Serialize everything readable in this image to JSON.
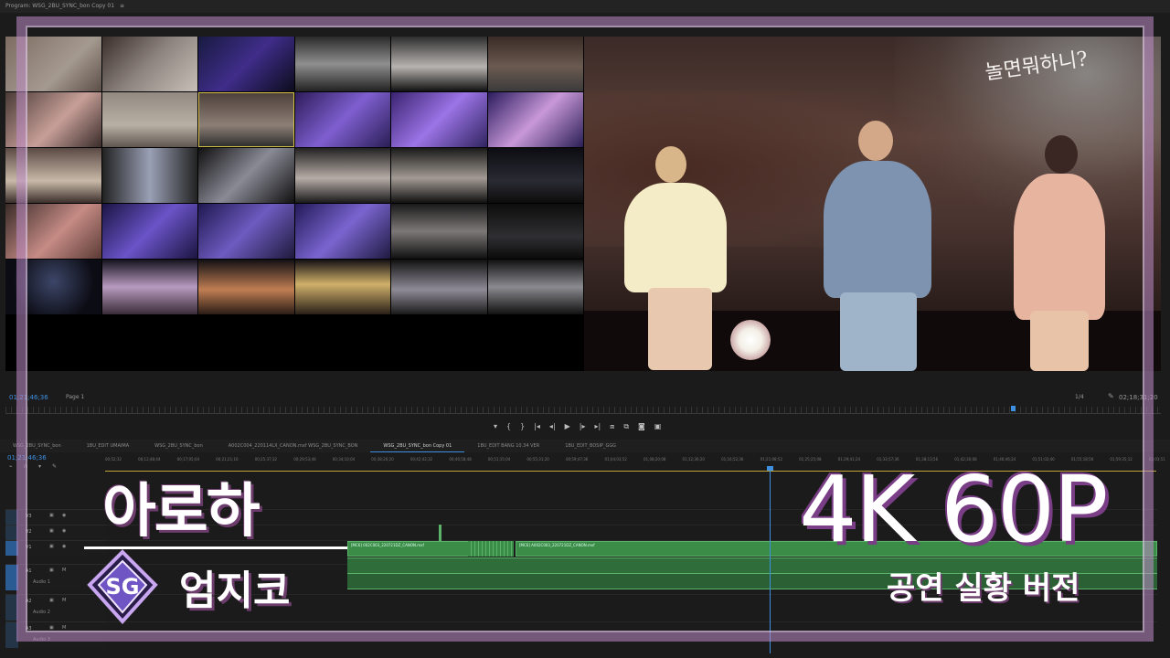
{
  "program_header": {
    "label": "Program: WSG_2BU_SYNC_bon Copy 01",
    "menu_icon": "hamburger-icon"
  },
  "monitor": {
    "timecode_left": "01;21;46;36",
    "page_select": "Page 1",
    "zoom": "1/4",
    "timecode_right": "02;18;31;20",
    "overlay_logo": "놀면뭐하니?"
  },
  "transport": {
    "buttons": [
      "marker-icon",
      "mark-in-icon",
      "mark-out-icon",
      "go-to-in-icon",
      "step-back-icon",
      "play-icon",
      "step-forward-icon",
      "go-to-out-icon",
      "insert-icon",
      "overwrite-icon",
      "export-frame-icon",
      "compare-icon"
    ]
  },
  "timeline": {
    "timecode": "01;21;46;36",
    "tabs": [
      {
        "label": "WSG_2BU_SYNC_bon",
        "active": false
      },
      {
        "label": "1BU_EDIT UMAIMA",
        "active": false
      },
      {
        "label": "WSG_2BU_SYNC_bon",
        "active": false
      },
      {
        "label": "A002C004_220114LX_CANON.mxf WSG_2BU_SYNC_BON",
        "active": false
      },
      {
        "label": "WSG_2BU_SYNC_bon Copy 01",
        "active": true
      },
      {
        "label": "1BU_EDIT BANG 10.34 VER",
        "active": false
      },
      {
        "label": "1BU_EDIT_BOSIP_GGG",
        "active": false
      }
    ],
    "ruler": [
      "00;52;32",
      "00;12;48;44",
      "00;17;05;04",
      "00;21;21;16",
      "00;25;37;32",
      "00;29;53;48",
      "00;34;10;04",
      "00;38;26;20",
      "00;42;42;32",
      "00;46;58;48",
      "00;51;15;04",
      "00;55;31;20",
      "00;59;47;36",
      "01;04;03;52",
      "01;08;20;08",
      "01;12;36;20",
      "01;16;52;36",
      "01;21;08;52",
      "01;25;25;08",
      "01;29;41;24",
      "01;33;57;36",
      "01;38;13;56",
      "01;42;30;08",
      "01;46;46;24",
      "01;51;02;40",
      "01;55;18;56",
      "01;59;35;12",
      "02;03;51"
    ],
    "tracks": [
      {
        "name": "V3",
        "label": ""
      },
      {
        "name": "V2",
        "label": ""
      },
      {
        "name": "V1",
        "label": ""
      },
      {
        "name": "A1",
        "label": "Audio 1"
      },
      {
        "name": "A2",
        "label": "Audio 2"
      },
      {
        "name": "A3",
        "label": "Audio 3"
      }
    ],
    "clip1": "[MC6] 002C003_220721DZ_CANON.mxf",
    "clip2": "[MC6] A002C003_220721DZ_CANON.mxf"
  },
  "overlay": {
    "song_title": "아로하",
    "artist": "엄지코",
    "quality": "4K 60P",
    "version": "공연 실황 버전"
  },
  "colors": {
    "frame": "#bd8cc8",
    "accent": "#3f8fe0",
    "clip": "#3a8c47",
    "text_shadow": "#6c3c6c"
  }
}
